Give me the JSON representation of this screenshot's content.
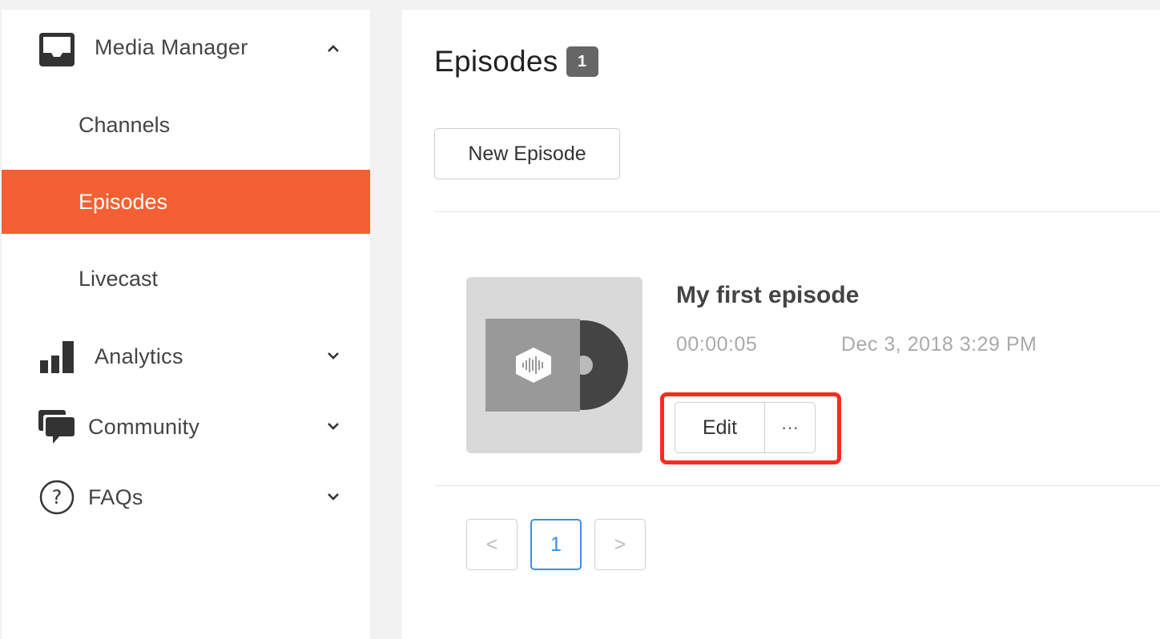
{
  "sidebar": {
    "media_manager": "Media Manager",
    "subitems": [
      "Channels",
      "Episodes",
      "Livecast"
    ],
    "active_item": "Episodes",
    "analytics": "Analytics",
    "community": "Community",
    "faqs": "FAQs"
  },
  "main": {
    "title": "Episodes",
    "count": "1",
    "new_episode_label": "New Episode",
    "episode": {
      "title": "My first episode",
      "duration": "00:00:05",
      "date": "Dec 3, 2018 3:29 PM",
      "edit_label": "Edit",
      "more_label": "···"
    },
    "pagination": {
      "prev": "<",
      "current": "1",
      "next": ">"
    }
  },
  "colors": {
    "accent": "#f46033",
    "highlight": "#ff2a1f",
    "page_active": "#3a8ee6"
  },
  "icons": [
    "inbox-tray-icon",
    "chevron-up-icon",
    "bar-chart-icon",
    "chevron-down-icon",
    "chat-bubbles-icon",
    "question-circle-icon",
    "vinyl-record-icon",
    "podcast-logo-icon"
  ]
}
